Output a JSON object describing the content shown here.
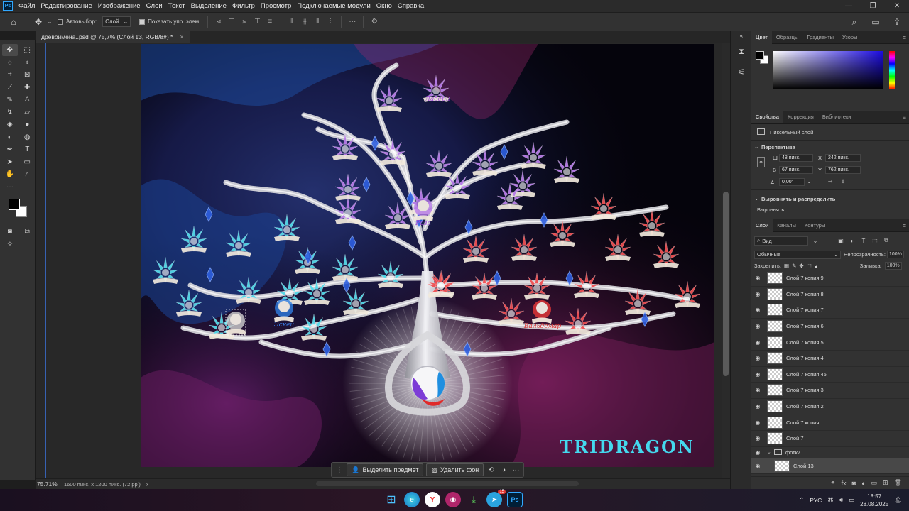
{
  "app": {
    "logo_text": "Ps"
  },
  "menu": {
    "items": [
      "Файл",
      "Редактирование",
      "Изображение",
      "Слои",
      "Текст",
      "Выделение",
      "Фильтр",
      "Просмотр",
      "Подключаемые модули",
      "Окно",
      "Справка"
    ]
  },
  "window_controls": {
    "minimize": "—",
    "restore": "❐",
    "close": "✕"
  },
  "options_bar": {
    "auto_select_label": "Автовыбор:",
    "auto_select_value": "Слой",
    "show_controls_label": "Показать упр. элем."
  },
  "document": {
    "tab_title": "древоимена..psd @ 75,7% (Слой 13, RGB/8#) *",
    "tab_close": "×"
  },
  "status_bar": {
    "zoom": "75.71%",
    "doc_size": "1600 пикс. x 1200 пикс. (72 ppi)",
    "arrow": "›"
  },
  "contextual_task_bar": {
    "select_subject": "Выделить предмет",
    "remove_background": "Удалить фон",
    "more": "···"
  },
  "artwork": {
    "brand_text": "TRIDRAGON",
    "banner_labels": {
      "top": "Лаверн",
      "center": "Роза",
      "left": "Эскей",
      "right": "Вальдемар"
    },
    "colors": {
      "purple_flowers": "#b77be8",
      "cyan_flowers": "#52d8e8",
      "red_flowers": "#ef4f52",
      "tree": "#d8d8dc",
      "brand": "#44d9ee"
    }
  },
  "color_panel": {
    "tabs": [
      "Цвет",
      "Образцы",
      "Градиенты",
      "Узоры"
    ],
    "active_tab": "Цвет"
  },
  "properties_panel": {
    "tabs": [
      "Свойства",
      "Коррекция",
      "Библиотеки"
    ],
    "active_tab": "Свойства",
    "layer_kind": "Пиксельный слой",
    "section_transform": "Перспектива",
    "w_label": "Ш",
    "w_value": "48 пикс.",
    "h_label": "В",
    "h_value": "67 пикс.",
    "x_label": "X",
    "x_value": "242 пикс.",
    "y_label": "Y",
    "y_value": "762 пикс.",
    "angle_value": "0,00°",
    "section_align": "Выровнять и распределить",
    "align_label": "Выровнять:"
  },
  "layers_panel": {
    "tabs": [
      "Слои",
      "Каналы",
      "Контуры"
    ],
    "active_tab": "Слои",
    "filter_label": "Вид",
    "blend_mode": "Обычные",
    "opacity_label": "Непрозрачность:",
    "opacity_value": "100%",
    "lock_label": "Закрепить:",
    "fill_label": "Заливка:",
    "fill_value": "100%",
    "layers": [
      {
        "name": "Слой 7 копия 9",
        "type": "pixel"
      },
      {
        "name": "Слой 7 копия 8",
        "type": "pixel"
      },
      {
        "name": "Слой 7 копия 7",
        "type": "pixel"
      },
      {
        "name": "Слой 7 копия 6",
        "type": "pixel"
      },
      {
        "name": "Слой 7 копия 5",
        "type": "pixel"
      },
      {
        "name": "Слой 7 копия 4",
        "type": "pixel"
      },
      {
        "name": "Слой 7 копия 45",
        "type": "pixel"
      },
      {
        "name": "Слой 7 копия 3",
        "type": "pixel"
      },
      {
        "name": "Слой 7 копия 2",
        "type": "pixel"
      },
      {
        "name": "Слой 7 копия",
        "type": "pixel"
      },
      {
        "name": "Слой 7",
        "type": "pixel"
      },
      {
        "name": "фотки",
        "type": "group"
      },
      {
        "name": "Слой 13",
        "type": "pixel",
        "selected": true
      }
    ]
  },
  "taskbar": {
    "language": "РУС",
    "time": "18:57",
    "date": "28.08.2025",
    "telegram_badge": "15"
  }
}
